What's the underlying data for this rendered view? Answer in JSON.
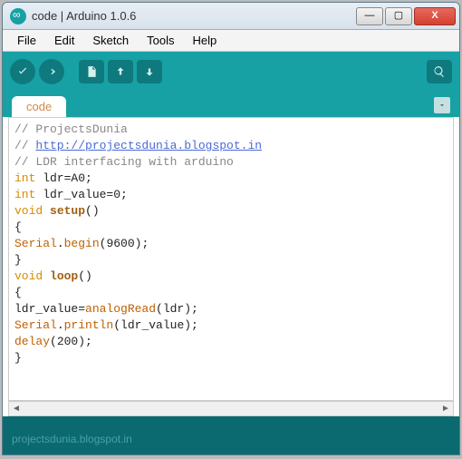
{
  "window": {
    "title": "code | Arduino 1.0.6"
  },
  "menu": {
    "file": "File",
    "edit": "Edit",
    "sketch": "Sketch",
    "tools": "Tools",
    "help": "Help"
  },
  "tabs": {
    "active": "code"
  },
  "code": {
    "l1a": "// ProjectsDunia",
    "l2a": "// ",
    "l2b": "http://projectsdunia.blogspot.in",
    "l3a": "// LDR interfacing with arduino",
    "l4a": "int",
    "l4b": " ldr=A0;",
    "l5a": "int",
    "l5b": " ldr_value=0;",
    "l6a": "void",
    "l6b": "setup",
    "l6c": "()",
    "l7a": "{",
    "l8a": "Serial",
    "l8b": ".",
    "l8c": "begin",
    "l8d": "(9600);",
    "l9a": "}",
    "l10a": "void",
    "l10b": "loop",
    "l10c": "()",
    "l11a": "{",
    "l12a": "ldr_value=",
    "l12b": "analogRead",
    "l12c": "(ldr);",
    "l13a": "Serial",
    "l13b": ".",
    "l13c": "println",
    "l13d": "(ldr_value);",
    "l14a": "delay",
    "l14b": "(200);",
    "l15a": "}"
  },
  "status": {
    "text": "projectsdunia.blogspot.in"
  }
}
